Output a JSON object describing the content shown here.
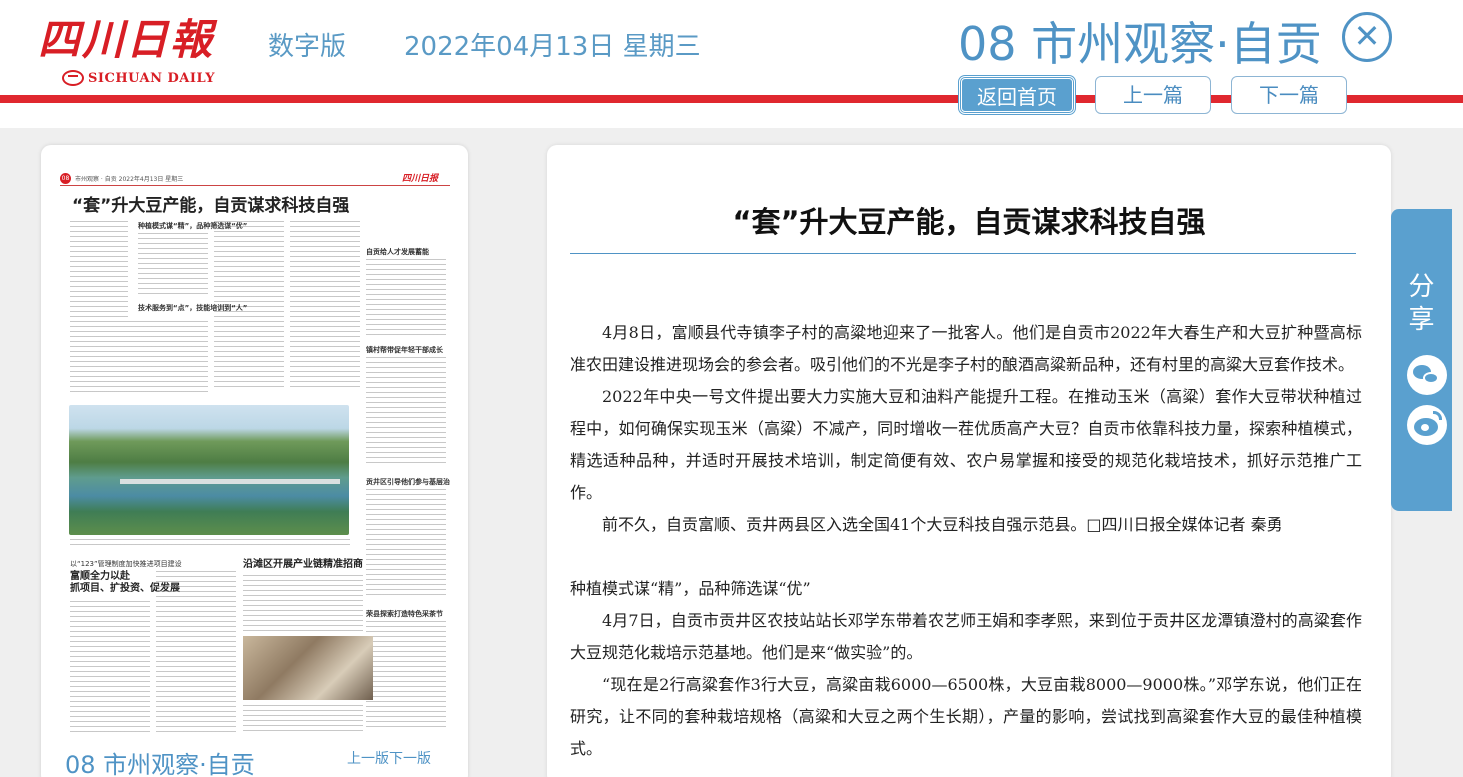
{
  "header": {
    "logo_cn": "四川日報",
    "logo_en": "SICHUAN DAILY",
    "edition": "数字版",
    "date": "2022年04月13日 星期三",
    "page_title": "08 市州观察·自贡",
    "close_symbol": "✕",
    "nav": {
      "home": "返回首页",
      "prev": "上一篇",
      "next": "下一篇"
    }
  },
  "thumbnail": {
    "page_num": "08",
    "masthead_line": "市州观察 · 自贡   2022年4月13日 星期三",
    "logo": "四川日报",
    "headline": "“套”升大豆产能，自贡谋求科技自强",
    "sub1": "种植模式谋“精”，品种筛选谋“优”",
    "sub2": "技术服务到“点”，技能培训到“人”",
    "side1": "自贡给人才发展蓄能",
    "side2": "镇村帮带促年轻干部成长",
    "side3": "贡井区引导他们参与基层治理",
    "side4": "荣县探索打造特色采茶节",
    "story2_kicker": "以“123”管理制度加快推进项目建设",
    "story2_title_1": "富顺全力以赴",
    "story2_title_2": "抓项目、扩投资、促发展",
    "story3_title": "沿滩区开展产业链精准招商"
  },
  "panel": {
    "caption": "08 市州观察·自贡",
    "links": "上一版下一版"
  },
  "article": {
    "title": "“套”升大豆产能，自贡谋求科技自强",
    "p1": "4月8日，富顺县代寺镇李子村的高粱地迎来了一批客人。他们是自贡市2022年大春生产和大豆扩种暨高标准农田建设推进现场会的参会者。吸引他们的不光是李子村的酿酒高粱新品种，还有村里的高粱大豆套作技术。",
    "p2": "2022年中央一号文件提出要大力实施大豆和油料产能提升工程。在推动玉米（高粱）套作大豆带状种植过程中，如何确保实现玉米（高粱）不减产，同时增收一茬优质高产大豆？自贡市依靠科技力量，探索种植模式，精选适种品种，并适时开展技术培训，制定简便有效、农户易掌握和接受的规范化栽培技术，抓好示范推广工作。",
    "p3": "前不久，自贡富顺、贡井两县区入选全国41个大豆科技自强示范县。□四川日报全媒体记者 秦勇",
    "subhead": "种植模式谋“精”，品种筛选谋“优”",
    "p4": "4月7日，自贡市贡井区农技站站长邓学东带着农艺师王娟和李孝熙，来到位于贡井区龙潭镇澄村的高粱套作大豆规范化栽培示范基地。他们是来“做实验”的。",
    "p5": "“现在是2行高粱套作3行大豆，高粱亩栽6000—6500株，大豆亩栽8000—9000株。”邓学东说，他们正在研究，让不同的套种栽培规格（高粱和大豆之两个生长期），产量的影响，尝试找到高粱套作大豆的最佳种植模式。"
  },
  "share": {
    "label": "分享"
  }
}
